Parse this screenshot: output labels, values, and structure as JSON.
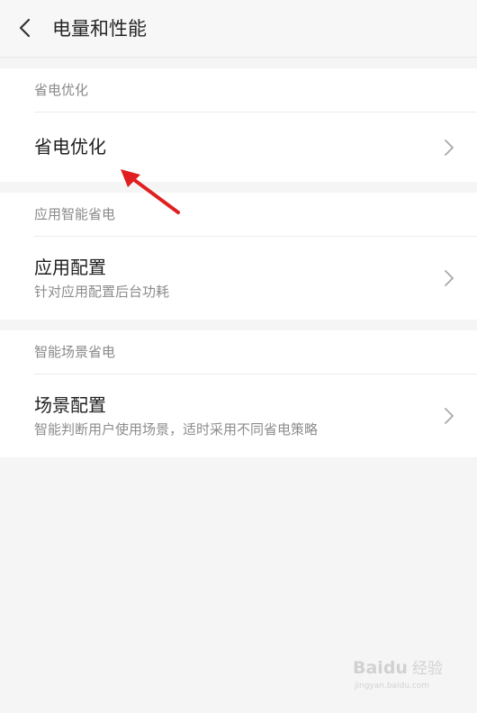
{
  "header": {
    "title": "电量和性能"
  },
  "sections": [
    {
      "header": "省电优化",
      "rows": [
        {
          "title": "省电优化",
          "subtitle": ""
        }
      ]
    },
    {
      "header": "应用智能省电",
      "rows": [
        {
          "title": "应用配置",
          "subtitle": "针对应用配置后台功耗"
        }
      ]
    },
    {
      "header": "智能场景省电",
      "rows": [
        {
          "title": "场景配置",
          "subtitle": "智能判断用户使用场景，适时采用不同省电策略"
        }
      ]
    }
  ],
  "annotation": {
    "arrow_color": "#e02020"
  },
  "watermark": {
    "brand": "Baidu",
    "brand_cn": "经验",
    "url": "jingyan.baidu.com"
  },
  "colors": {
    "background": "#f5f5f5",
    "card": "#ffffff",
    "title_text": "#1e1e1e",
    "secondary_text": "#8c8c8c"
  },
  "icons": {
    "back": "chevron-left-icon",
    "row_action": "chevron-right-icon"
  }
}
